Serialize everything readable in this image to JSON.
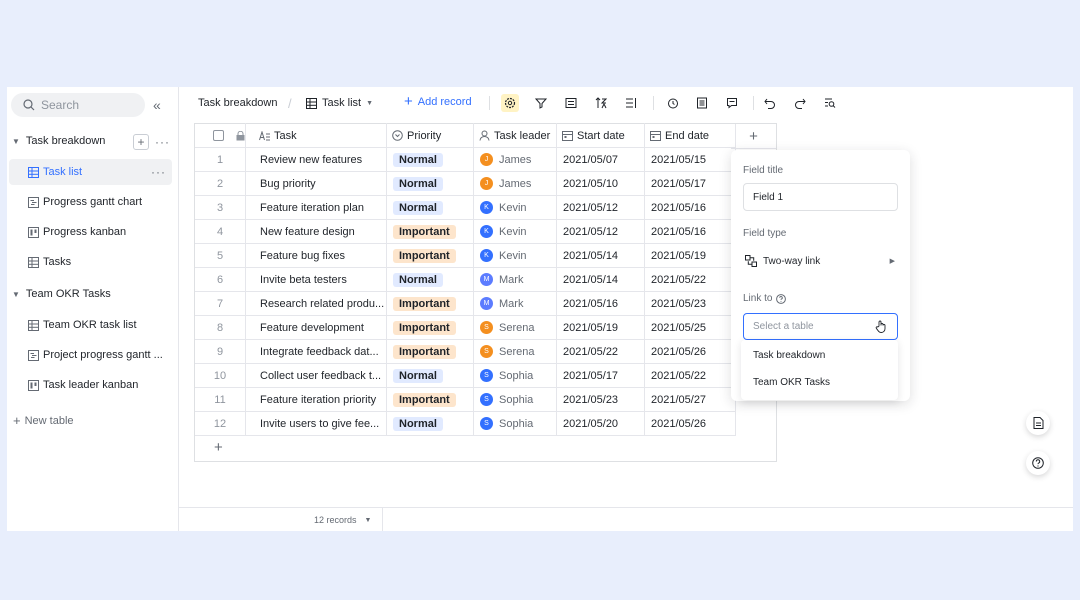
{
  "sidebar": {
    "search_placeholder": "Search",
    "collapse_icon": "double-chevron-left-icon",
    "groups": [
      {
        "label": "Task breakdown",
        "items": [
          "Task list",
          "Progress gantt chart",
          "Progress kanban",
          "Tasks"
        ]
      },
      {
        "label": "Team OKR Tasks",
        "items": [
          "Team OKR task list",
          "Project progress gantt ...",
          "Task leader kanban"
        ]
      }
    ],
    "new_table": "New table"
  },
  "toolbar": {
    "breadcrumb": "Task breakdown",
    "view_name": "Task list",
    "add_record": "Add record",
    "icons": [
      "settings-icon",
      "filter-icon",
      "group-icon",
      "sort-icon",
      "row-height-icon",
      "reminder-icon",
      "form-icon",
      "comment-icon",
      "undo-icon",
      "redo-icon",
      "search-icon"
    ]
  },
  "table": {
    "columns": [
      "Task",
      "Priority",
      "Task leader",
      "Start date",
      "End date"
    ],
    "rows": [
      {
        "n": "1",
        "task": "Review new features",
        "priority": "Normal",
        "leader": "James",
        "initial": "J",
        "start": "2021/05/07",
        "end": "2021/05/15"
      },
      {
        "n": "2",
        "task": "Bug priority",
        "priority": "Normal",
        "leader": "James",
        "initial": "J",
        "start": "2021/05/10",
        "end": "2021/05/17"
      },
      {
        "n": "3",
        "task": "Feature iteration plan",
        "priority": "Normal",
        "leader": "Kevin",
        "initial": "K",
        "start": "2021/05/12",
        "end": "2021/05/16"
      },
      {
        "n": "4",
        "task": "New feature design",
        "priority": "Important",
        "leader": "Kevin",
        "initial": "K",
        "start": "2021/05/12",
        "end": "2021/05/16"
      },
      {
        "n": "5",
        "task": "Feature bug fixes",
        "priority": "Important",
        "leader": "Kevin",
        "initial": "K",
        "start": "2021/05/14",
        "end": "2021/05/19"
      },
      {
        "n": "6",
        "task": "Invite beta testers",
        "priority": "Normal",
        "leader": "Mark",
        "initial": "M",
        "start": "2021/05/14",
        "end": "2021/05/22"
      },
      {
        "n": "7",
        "task": "Research related produ...",
        "priority": "Important",
        "leader": "Mark",
        "initial": "M",
        "start": "2021/05/16",
        "end": "2021/05/23"
      },
      {
        "n": "8",
        "task": "Feature development",
        "priority": "Important",
        "leader": "Serena",
        "initial": "S",
        "start": "2021/05/19",
        "end": "2021/05/25"
      },
      {
        "n": "9",
        "task": "Integrate feedback dat...",
        "priority": "Important",
        "leader": "Serena",
        "initial": "S",
        "start": "2021/05/22",
        "end": "2021/05/26"
      },
      {
        "n": "10",
        "task": "Collect user feedback t...",
        "priority": "Normal",
        "leader": "Sophia",
        "initial": "S",
        "start": "2021/05/17",
        "end": "2021/05/22"
      },
      {
        "n": "11",
        "task": "Feature iteration priority",
        "priority": "Important",
        "leader": "Sophia",
        "initial": "S",
        "start": "2021/05/23",
        "end": "2021/05/27"
      },
      {
        "n": "12",
        "task": "Invite users to give fee...",
        "priority": "Normal",
        "leader": "Sophia",
        "initial": "S",
        "start": "2021/05/20",
        "end": "2021/05/26"
      }
    ],
    "colors": {
      "normal_bg": "#e1eaff",
      "normal_fg": "#1f2329",
      "important_bg": "#fde5cc",
      "important_fg": "#1f2329",
      "James": "#f48f1f",
      "Kevin": "#3370ff",
      "Mark": "#5c7cff",
      "Serena": "#f48f1f",
      "Sophia": "#3370ff"
    }
  },
  "panel": {
    "field_title_label": "Field title",
    "field_title_value": "Field 1",
    "field_type_label": "Field type",
    "field_type_value": "Two-way link",
    "link_to_label": "Link to",
    "select_placeholder": "Select a table",
    "options": [
      "Task breakdown",
      "Team OKR Tasks"
    ]
  },
  "footer": {
    "records": "12 records"
  }
}
